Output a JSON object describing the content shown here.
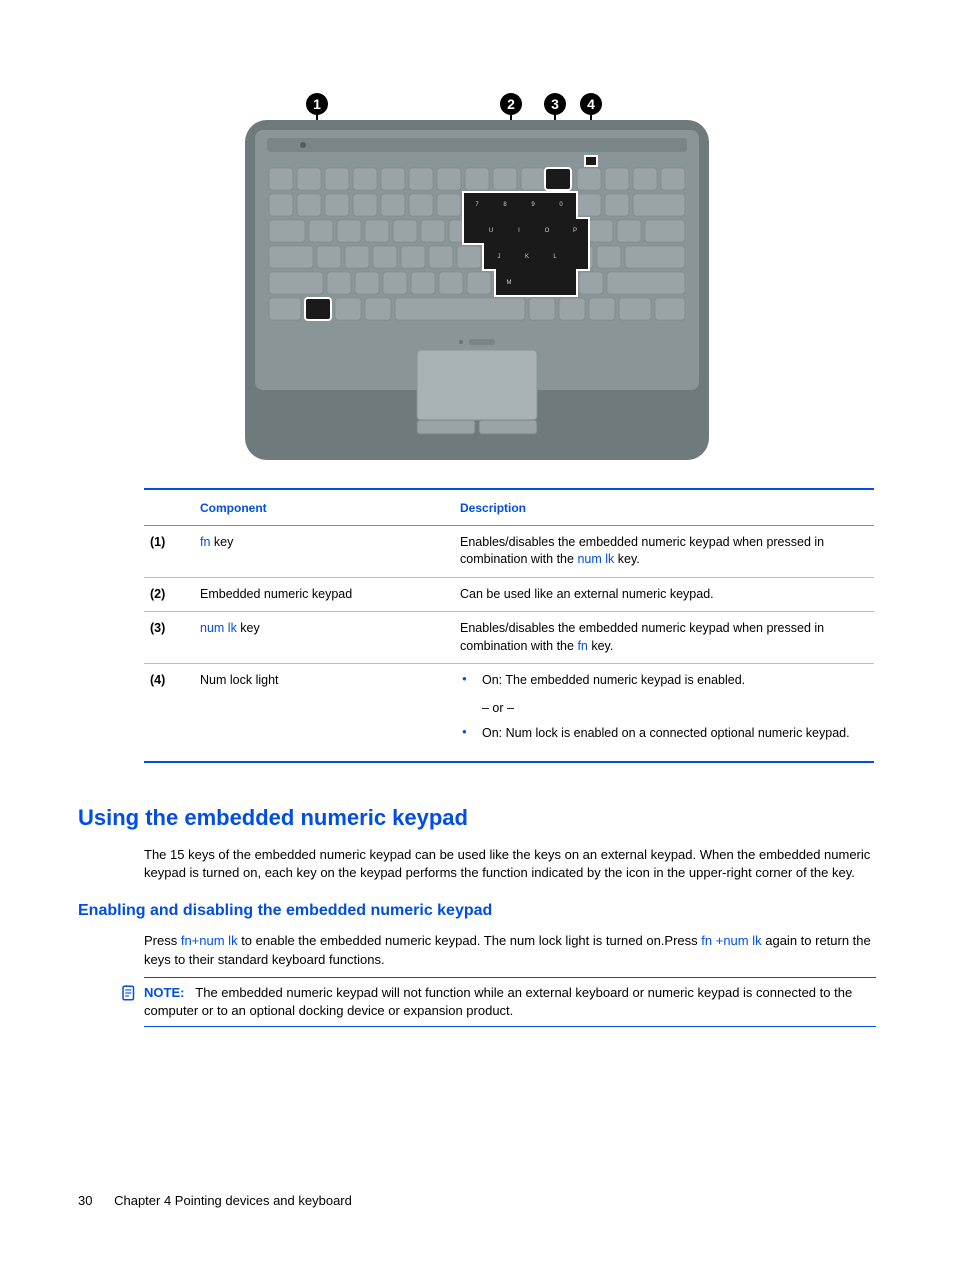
{
  "callouts": [
    "1",
    "2",
    "3",
    "4"
  ],
  "table": {
    "headers": {
      "component": "Component",
      "description": "Description"
    },
    "rows": [
      {
        "num": "(1)",
        "comp_link": "fn",
        "comp_rest": " key",
        "desc_pre": "Enables/disables the embedded numeric keypad when pressed in combination with the ",
        "desc_link": "num lk",
        "desc_post": " key."
      },
      {
        "num": "(2)",
        "comp_plain": "Embedded numeric keypad",
        "desc_plain": "Can be used like an external numeric keypad."
      },
      {
        "num": "(3)",
        "comp_link": "num lk",
        "comp_rest": " key",
        "desc_pre": "Enables/disables the embedded numeric keypad when pressed in combination with the ",
        "desc_link": "fn",
        "desc_post": " key."
      },
      {
        "num": "(4)",
        "comp_plain": "Num lock light",
        "bullets": [
          "On: The embedded numeric keypad is enabled.",
          "On: Num lock is enabled on a connected optional numeric keypad."
        ],
        "or": "– or –"
      }
    ]
  },
  "section1": {
    "heading": "Using the embedded numeric keypad",
    "para": "The 15 keys of the embedded numeric keypad can be used like the keys on an external keypad. When the embedded numeric keypad is turned on, each key on the keypad performs the function indicated by the icon in the upper-right corner of the key."
  },
  "section2": {
    "heading": "Enabling and disabling the embedded numeric keypad",
    "para_pre": "Press ",
    "para_link1": "fn+num lk",
    "para_mid": " to enable the embedded numeric keypad. The num lock light is turned on.Press ",
    "para_link2": "fn +num lk",
    "para_post": " again to return the keys to their standard keyboard functions."
  },
  "note": {
    "label": "NOTE:",
    "text": "The embedded numeric keypad will not function while an external keyboard or numeric keypad is connected to the computer or to an optional docking device or expansion product."
  },
  "footer": {
    "page": "30",
    "chapter": "Chapter 4   Pointing devices and keyboard"
  }
}
